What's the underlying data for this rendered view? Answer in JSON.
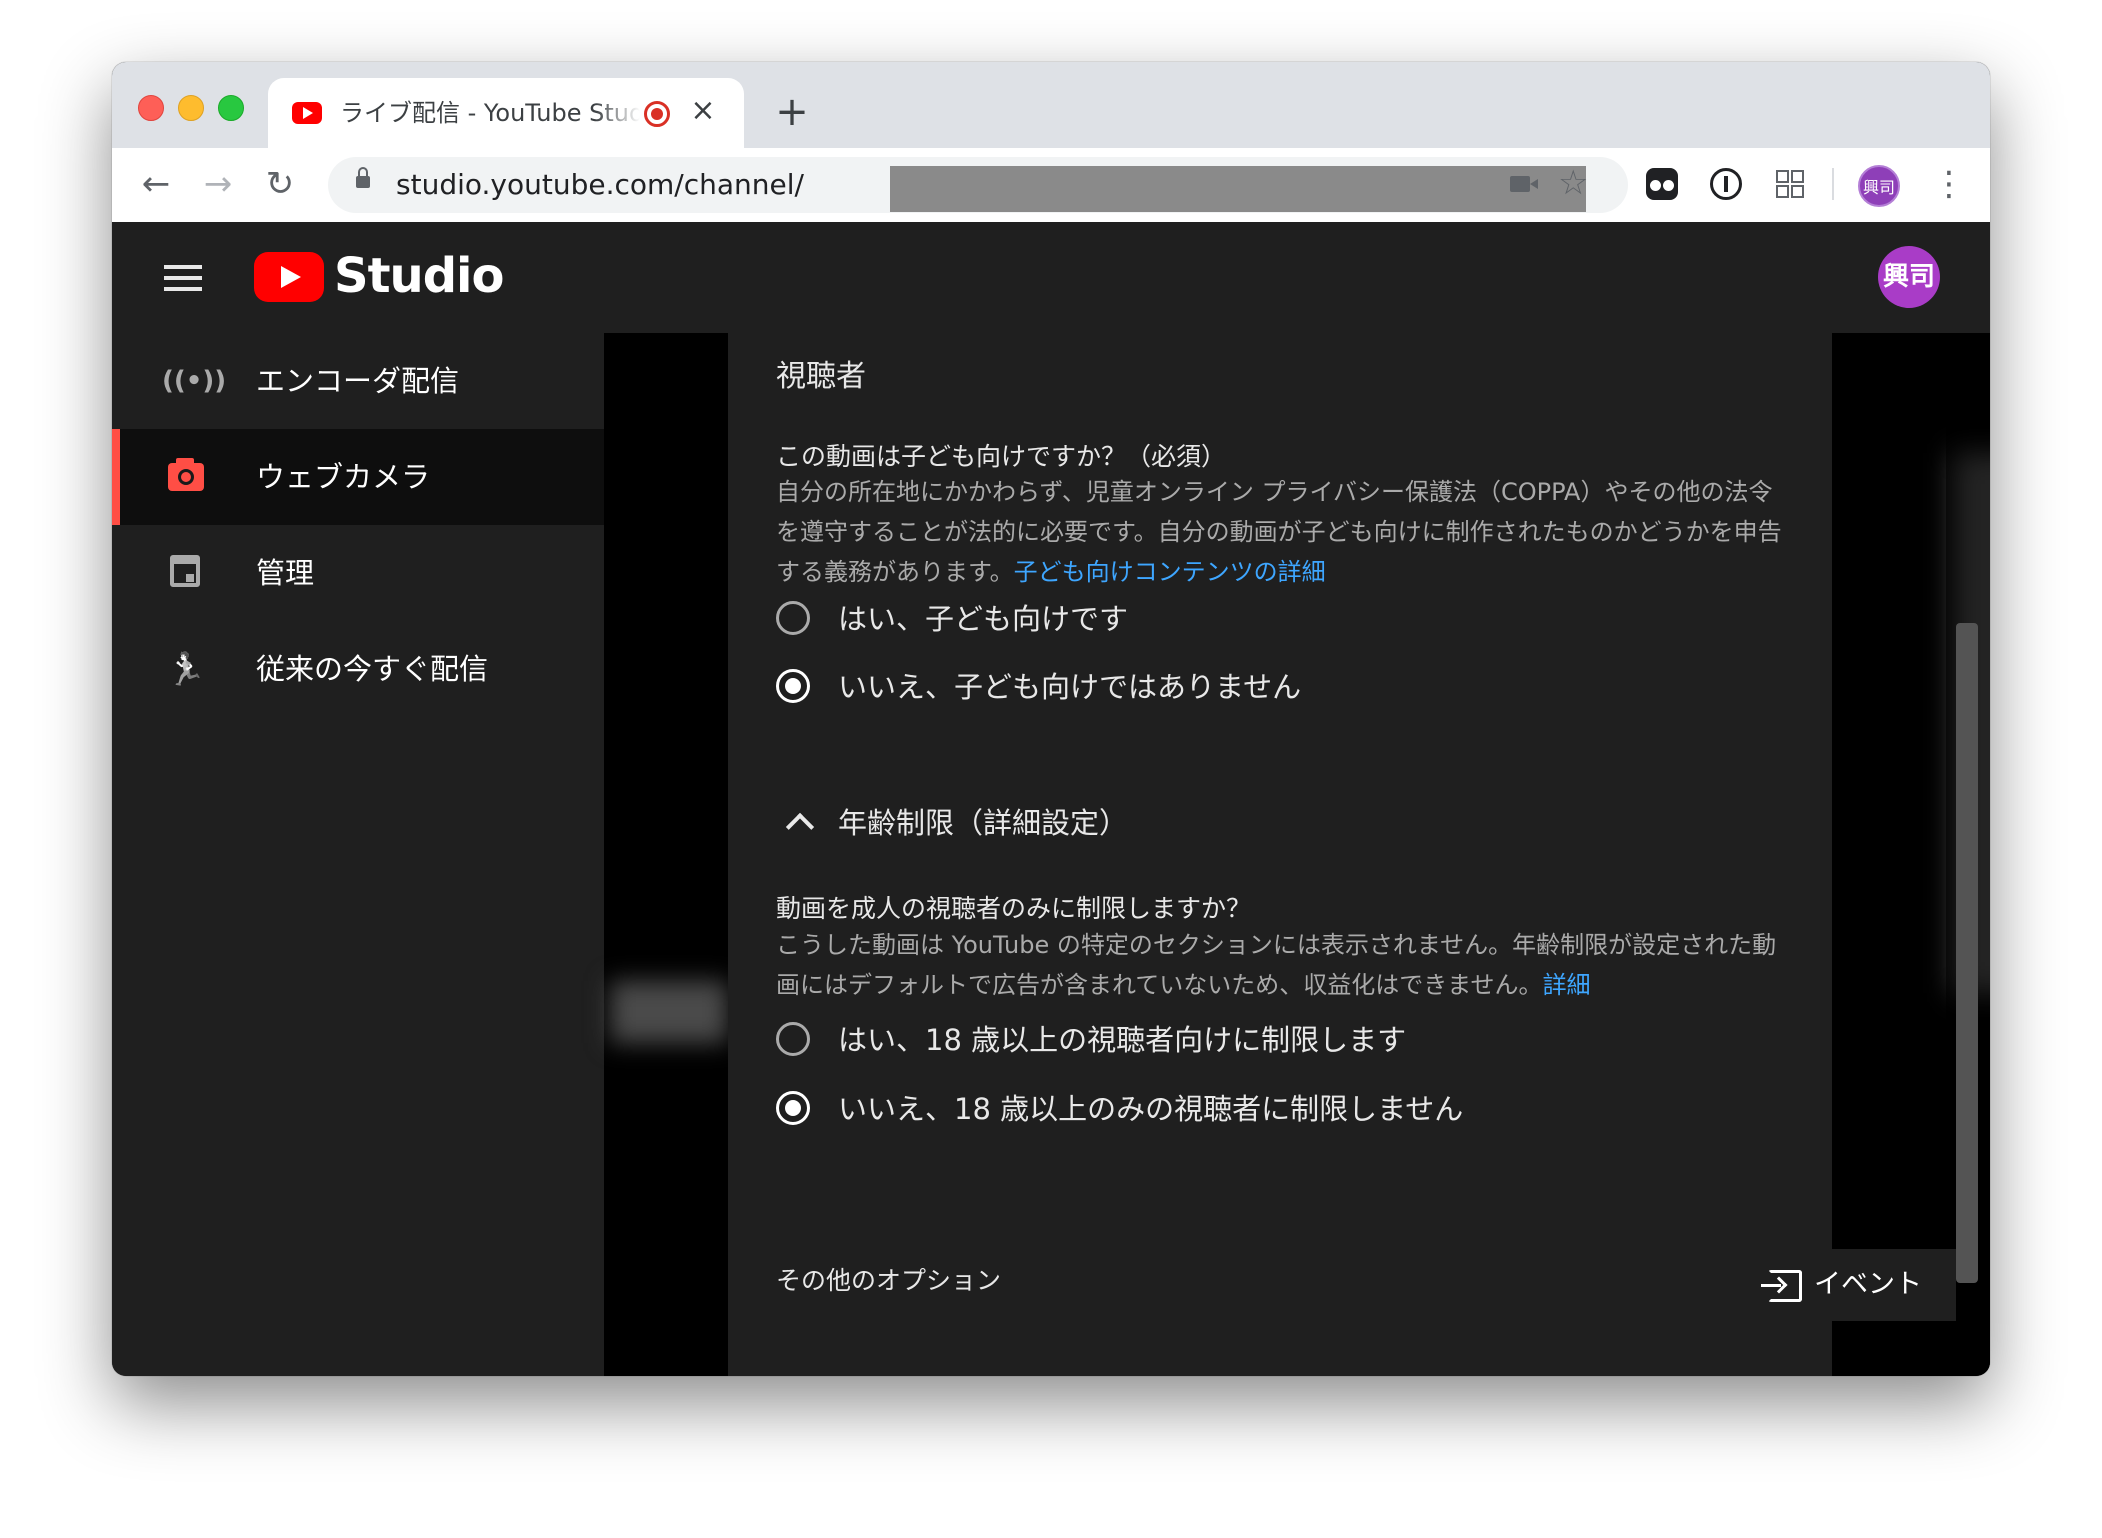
{
  "browser": {
    "tab_title": "ライブ配信 - YouTube Studio",
    "tab_close": "×",
    "new_tab": "+",
    "url": "studio.youtube.com/channel/",
    "profile_initials": "興司",
    "nav": {
      "back": "←",
      "forward": "→",
      "reload": "↻",
      "menu": "⋮",
      "bookmark": "☆"
    }
  },
  "app": {
    "logo_text": "Studio",
    "avatar_initials": "興司"
  },
  "sidebar": {
    "items": [
      {
        "label": "エンコーダ配信",
        "icon": "broadcast-icon",
        "glyph": "((•))",
        "active": false
      },
      {
        "label": "ウェブカメラ",
        "icon": "camera-icon",
        "active": true
      },
      {
        "label": "管理",
        "icon": "calendar-icon",
        "active": false
      },
      {
        "label": "従来の今すぐ配信",
        "icon": "exit-run-icon",
        "glyph": "🏃",
        "active": false
      }
    ]
  },
  "audience": {
    "title": "視聴者",
    "question": "この動画は子ども向けですか？（必須）",
    "description": "自分の所在地にかかわらず、児童オンライン プライバシー保護法（COPPA）やその他の法令を遵守することが法的に必要です。自分の動画が子ども向けに制作されたものかどうかを申告する義務があります。",
    "link": "子ども向けコンテンツの詳細",
    "options": [
      {
        "label": "はい、子ども向けです",
        "checked": false
      },
      {
        "label": "いいえ、子ども向けではありません",
        "checked": true
      }
    ]
  },
  "age_restriction": {
    "toggle_label": "年齢制限（詳細設定）",
    "question": "動画を成人の視聴者のみに制限しますか？",
    "description": "こうした動画は YouTube の特定のセクションには表示されません。年齢制限が設定された動画にはデフォルトで広告が含まれていないため、収益化はできません。",
    "link": "詳細",
    "options": [
      {
        "label": "はい、18 歳以上の視聴者向けに制限します",
        "checked": false
      },
      {
        "label": "いいえ、18 歳以上のみの視聴者に制限しません",
        "checked": true
      }
    ]
  },
  "other_options": "その他のオプション",
  "event_button": "イベント",
  "colors": {
    "accent_red": "#ff4e45",
    "link_blue": "#3ea6ff",
    "youtube_red": "#ff0000",
    "avatar_purple": "#a93cc7"
  }
}
